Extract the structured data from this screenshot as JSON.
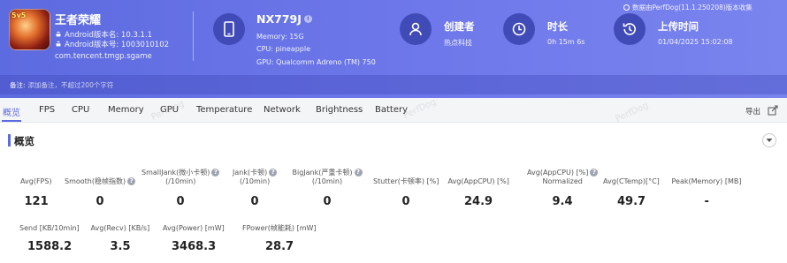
{
  "watermark_top": "数据由PerfDog(11.1.250208)版本收集",
  "app": {
    "icon_badge": "5v5",
    "name": "王者荣耀",
    "version": "Android版本名: 10.3.1.1",
    "version_code": "Android版本号: 1003010102",
    "package": "com.tencent.tmgp.sgame"
  },
  "device": {
    "name": "NX779J",
    "memory": "Memory: 15G",
    "cpu": "CPU: pineapple",
    "gpu": "GPU: Qualcomm Adreno (TM) 750"
  },
  "creator": {
    "title": "创建者",
    "value": "热点科技"
  },
  "duration": {
    "title": "时长",
    "value": "0h 15m 6s"
  },
  "upload": {
    "title": "上传时间",
    "value": "01/04/2025 15:02:08"
  },
  "note": {
    "label": "备注:",
    "placeholder": "添加备注，不超过200个字符"
  },
  "tabs": [
    "概览",
    "FPS",
    "CPU",
    "Memory",
    "GPU",
    "Temperature",
    "Network",
    "Brightness",
    "Battery"
  ],
  "export_label": "导出",
  "watermark": "PerfDog",
  "section_title": "概览",
  "metrics_row1": [
    {
      "label": "Avg(FPS)",
      "value": "121"
    },
    {
      "label": "Smooth(稳帧指数)",
      "value": "0"
    },
    {
      "label": "SmallJank(微小卡顿)\n(/10min)",
      "value": "0"
    },
    {
      "label": "Jank(卡顿)\n(/10min)",
      "value": "0"
    },
    {
      "label": "BigJank(严重卡顿)\n(/10min)",
      "value": "0"
    },
    {
      "label": "Stutter(卡顿率) [%]",
      "value": "0"
    },
    {
      "label": "Avg(AppCPU) [%]",
      "value": "24.9"
    },
    {
      "label": "Avg(AppCPU) [%]\nNormalized",
      "value": "9.4"
    },
    {
      "label": "Avg(CTemp)[°C]",
      "value": "49.7"
    },
    {
      "label": "Peak(Memory) [MB]",
      "value": "-"
    }
  ],
  "metrics_row2": [
    {
      "label": "Send [KB/10min]",
      "value": "1588.2"
    },
    {
      "label": "Avg(Recv) [KB/s]",
      "value": "3.5"
    },
    {
      "label": "Avg(Power) [mW]",
      "value": "3468.3"
    },
    {
      "label": "FPower(帧能耗) [mW]",
      "value": "28.7"
    }
  ],
  "help_glyph": "?",
  "colors": {
    "accent": "#5d6be0",
    "header": "#6b76e8",
    "icon_circle": "#414bb8"
  }
}
